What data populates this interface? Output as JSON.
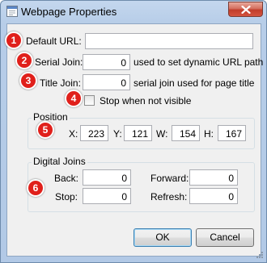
{
  "window": {
    "title": "Webpage Properties",
    "close_icon": "close-icon",
    "app_icon": "webpage-properties-icon"
  },
  "fields": {
    "default_url": {
      "label": "Default URL:",
      "value": ""
    },
    "serial_join": {
      "label": "Serial Join:",
      "value": "0",
      "hint": "used to set dynamic URL path"
    },
    "title_join": {
      "label": "Title Join:",
      "value": "0",
      "hint": "serial join used for page title"
    },
    "stop_when_not_visible": {
      "label": "Stop when not visible",
      "checked": false
    }
  },
  "position": {
    "legend": "Position",
    "x": {
      "label": "X:",
      "value": "223"
    },
    "y": {
      "label": "Y:",
      "value": "121"
    },
    "w": {
      "label": "W:",
      "value": "154"
    },
    "h": {
      "label": "H:",
      "value": "167"
    }
  },
  "digital_joins": {
    "legend": "Digital Joins",
    "back": {
      "label": "Back:",
      "value": "0"
    },
    "forward": {
      "label": "Forward:",
      "value": "0"
    },
    "stop": {
      "label": "Stop:",
      "value": "0"
    },
    "refresh": {
      "label": "Refresh:",
      "value": "0"
    }
  },
  "buttons": {
    "ok": "OK",
    "cancel": "Cancel"
  },
  "callouts": [
    "1",
    "2",
    "3",
    "4",
    "5",
    "6"
  ],
  "colors": {
    "callout": "#e0201b",
    "close_button": "#c13d2a",
    "title_bar": "#b9cfea",
    "dialog_background": "#f0f0f0"
  }
}
